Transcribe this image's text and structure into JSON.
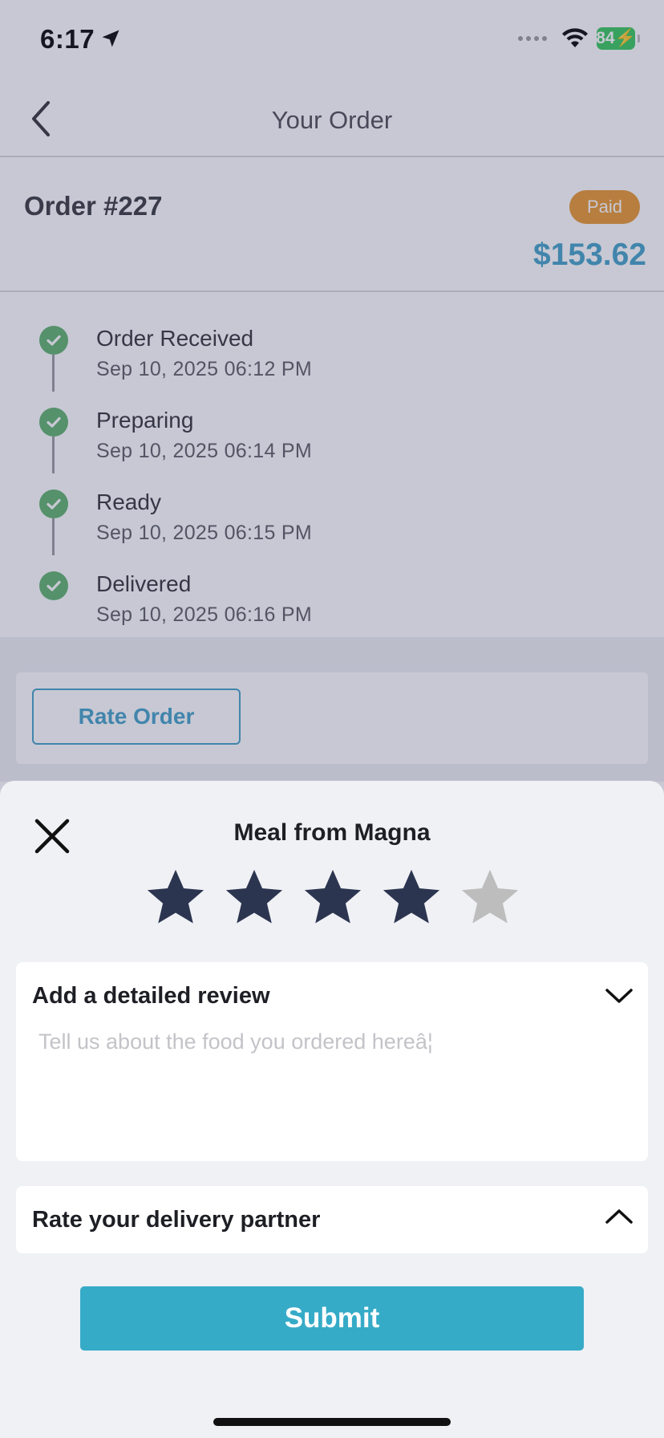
{
  "status_bar": {
    "time": "6:17",
    "battery": "84"
  },
  "nav": {
    "title": "Your Order"
  },
  "order": {
    "number": "Order #227",
    "status": "Paid",
    "total": "$153.62"
  },
  "timeline": [
    {
      "label": "Order Received",
      "time": "Sep 10, 2025 06:12 PM"
    },
    {
      "label": "Preparing",
      "time": "Sep 10, 2025 06:14 PM"
    },
    {
      "label": "Ready",
      "time": "Sep 10, 2025 06:15 PM"
    },
    {
      "label": "Delivered",
      "time": "Sep 10, 2025 06:16 PM"
    }
  ],
  "rate_order": {
    "label": "Rate Order"
  },
  "sheet": {
    "title": "Meal from Magna",
    "rating": {
      "value": 4,
      "max": 5
    },
    "review": {
      "title": "Add a detailed review",
      "placeholder": "Tell us about the food you ordered hereâ¦",
      "value": ""
    },
    "partner": {
      "title": "Rate your delivery partner"
    },
    "submit_label": "Submit"
  },
  "colors": {
    "accent": "#3f9fc7",
    "submit": "#36abc8",
    "paid_badge": "#e8962c",
    "check": "#5cb16b",
    "star_filled": "#2c3550",
    "star_empty": "#bdbdbd"
  },
  "icons": [
    "location-arrow-icon",
    "wifi-icon",
    "back-chevron-icon",
    "check-icon",
    "close-icon",
    "star-icon",
    "chevron-down-icon",
    "chevron-up-icon"
  ]
}
